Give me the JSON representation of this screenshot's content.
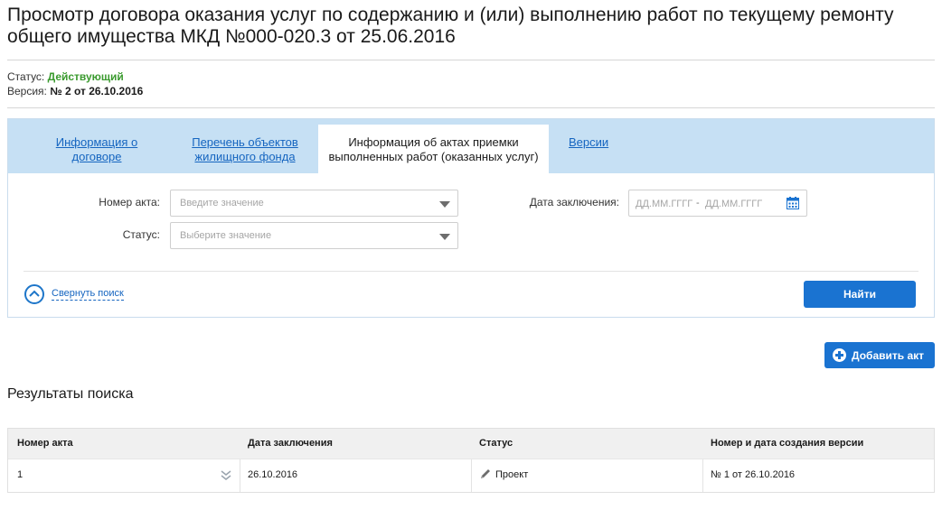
{
  "page": {
    "title": "Просмотр договора оказания услуг по содержанию и (или) выполнению работ по текущему ремонту общего имущества МКД №000-020.3 от 25.06.2016"
  },
  "meta": {
    "status_label": "Статус:",
    "status_value": "Действующий",
    "version_label": "Версия:",
    "version_value": "№ 2 от 26.10.2016"
  },
  "tabs": [
    {
      "label": "Информация о договоре",
      "active": false
    },
    {
      "label": "Перечень объектов жилищного фонда",
      "active": false
    },
    {
      "label": "Информация об актах приемки выполненных работ (оказанных услуг)",
      "active": true
    },
    {
      "label": "Версии",
      "active": false
    }
  ],
  "search": {
    "act_number_label": "Номер акта:",
    "act_number_placeholder": "Введите значение",
    "status_label": "Статус:",
    "status_placeholder": "Выберите значение",
    "date_label": "Дата заключения:",
    "date_from_placeholder": "ДД.ММ.ГГГГ",
    "date_separator": "-",
    "date_to_placeholder": "ДД.ММ.ГГГГ",
    "collapse_label": "Свернуть поиск",
    "find_button": "Найти"
  },
  "actions": {
    "add_act_button": "Добавить акт"
  },
  "results": {
    "title": "Результаты поиска",
    "columns": [
      "Номер акта",
      "Дата заключения",
      "Статус",
      "Номер и дата создания версии"
    ],
    "rows": [
      {
        "number": "1",
        "date": "26.10.2016",
        "status": "Проект",
        "version": "№ 1 от 26.10.2016"
      }
    ]
  },
  "colors": {
    "accent": "#1a73d1",
    "status_active": "#3a9a2e",
    "tab_strip": "#c6e0f4",
    "link": "#1565c0"
  }
}
